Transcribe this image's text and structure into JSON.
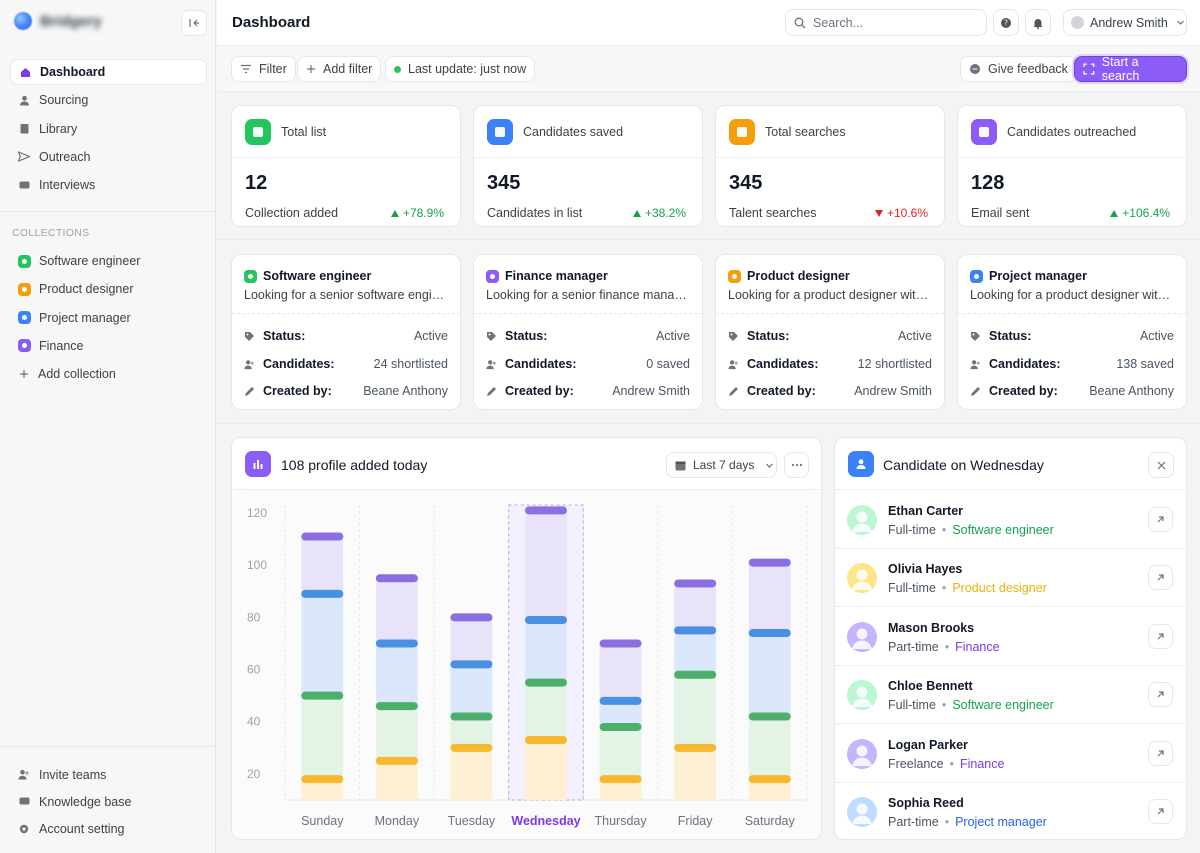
{
  "app": {
    "name": "Bridgery"
  },
  "sidebar": {
    "nav": [
      {
        "label": "Dashboard",
        "icon": "home-icon"
      },
      {
        "label": "Sourcing",
        "icon": "user-icon"
      },
      {
        "label": "Library",
        "icon": "book-icon"
      },
      {
        "label": "Outreach",
        "icon": "send-icon"
      },
      {
        "label": "Interviews",
        "icon": "chat-icon"
      }
    ],
    "collections_label": "COLLECTIONS",
    "collections": [
      {
        "label": "Software engineer",
        "color": "#22c55e"
      },
      {
        "label": "Product designer",
        "color": "#f59e0b"
      },
      {
        "label": "Project manager",
        "color": "#3b82f6"
      },
      {
        "label": "Finance",
        "color": "#8b5cf6"
      }
    ],
    "add_collection": "Add collection",
    "bottom": [
      {
        "label": "Invite teams",
        "icon": "users-icon"
      },
      {
        "label": "Knowledge base",
        "icon": "book-icon"
      },
      {
        "label": "Account setting",
        "icon": "gear-icon"
      }
    ]
  },
  "header": {
    "title": "Dashboard",
    "search_placeholder": "Search...",
    "user": "Andrew Smith"
  },
  "toolbar": {
    "filter": "Filter",
    "add_filter": "Add filter",
    "last_update": "Last update: just now",
    "feedback": "Give feedback",
    "start_search": "Start a search"
  },
  "stats": [
    {
      "label": "Total list",
      "value": "12",
      "sub": "Collection added",
      "change": "+78.9%",
      "dir": "up",
      "color": "#22c55e"
    },
    {
      "label": "Candidates saved",
      "value": "345",
      "sub": "Candidates in list",
      "change": "+38.2%",
      "dir": "up",
      "color": "#3b82f6"
    },
    {
      "label": "Total searches",
      "value": "345",
      "sub": "Talent searches",
      "change": "+10.6%",
      "dir": "down",
      "color": "#f59e0b"
    },
    {
      "label": "Candidates outreached",
      "value": "128",
      "sub": "Email sent",
      "change": "+106.4%",
      "dir": "up",
      "color": "#8b5cf6"
    }
  ],
  "collection_cards": {
    "status_key": "Status:",
    "candidates_key": "Candidates:",
    "created_key": "Created by:",
    "items": [
      {
        "title": "Software engineer",
        "desc": "Looking for a senior software engineer",
        "status": "Active",
        "candidates": "24 shortlisted",
        "created": "Beane Anthony",
        "color": "#22c55e"
      },
      {
        "title": "Finance manager",
        "desc": "Looking for a senior finance manager",
        "status": "Active",
        "candidates": "0 saved",
        "created": "Andrew Smith",
        "color": "#8b5cf6"
      },
      {
        "title": "Product designer",
        "desc": "Looking for a product designer with experience",
        "status": "Active",
        "candidates": "12 shortlisted",
        "created": "Andrew Smith",
        "color": "#f59e0b"
      },
      {
        "title": "Project manager",
        "desc": "Looking for a product designer with experience",
        "status": "Active",
        "candidates": "138 saved",
        "created": "Beane Anthony",
        "color": "#3b82f6"
      }
    ]
  },
  "chart_panel": {
    "title": "108 profile added today",
    "range": "Last 7 days"
  },
  "chart_data": {
    "type": "bar",
    "stacked": true,
    "categories": [
      "Sunday",
      "Monday",
      "Tuesday",
      "Wednesday",
      "Thursday",
      "Friday",
      "Saturday"
    ],
    "highlight": "Wednesday",
    "ylim": [
      10,
      125
    ],
    "yticks": [
      20,
      40,
      60,
      80,
      100,
      120
    ],
    "series": [
      {
        "color": "#f5b82e",
        "fill": "#fdf0d5",
        "values": [
          18,
          25,
          30,
          33,
          18,
          30,
          18
        ]
      },
      {
        "color": "#4caf6a",
        "fill": "#e3f4e6",
        "values": [
          50,
          46,
          42,
          55,
          38,
          58,
          42
        ]
      },
      {
        "color": "#4a90e2",
        "fill": "#dbe8fb",
        "values": [
          89,
          70,
          62,
          79,
          48,
          75,
          74
        ]
      },
      {
        "color": "#8b6fe0",
        "fill": "#e9e3fa",
        "values": [
          111,
          95,
          80,
          121,
          70,
          93,
          101
        ]
      }
    ]
  },
  "candidates_panel": {
    "title": "Candidate on Wednesday",
    "items": [
      {
        "name": "Ethan Carter",
        "type": "Full-time",
        "role": "Software engineer",
        "color": "#16a34a",
        "avatar": "#bbf7d0"
      },
      {
        "name": "Olivia Hayes",
        "type": "Full-time",
        "role": "Product designer",
        "color": "#eab308",
        "avatar": "#fde68a"
      },
      {
        "name": "Mason Brooks",
        "type": "Part-time",
        "role": "Finance",
        "color": "#7c3aed",
        "avatar": "#c4b5fd"
      },
      {
        "name": "Chloe Bennett",
        "type": "Full-time",
        "role": "Software engineer",
        "color": "#16a34a",
        "avatar": "#bbf7d0"
      },
      {
        "name": "Logan Parker",
        "type": "Freelance",
        "role": "Finance",
        "color": "#7c3aed",
        "avatar": "#c4b5fd"
      },
      {
        "name": "Sophia Reed",
        "type": "Part-time",
        "role": "Project manager",
        "color": "#2563eb",
        "avatar": "#bfdbfe"
      }
    ]
  }
}
